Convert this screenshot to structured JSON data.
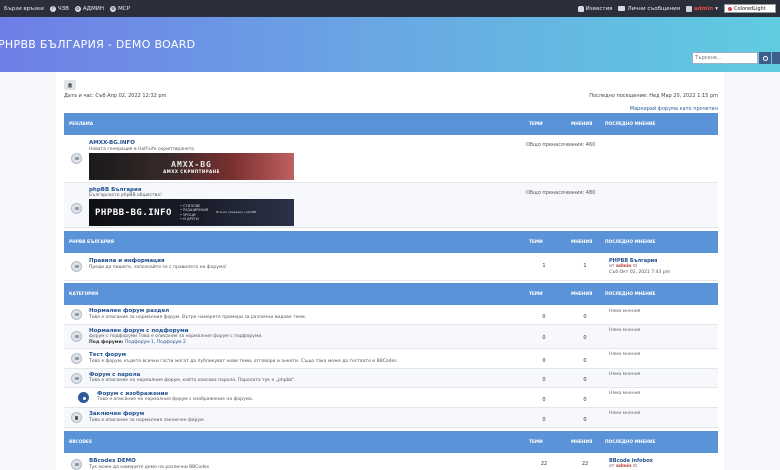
{
  "topbar": {
    "quick_links": "Бързи връзки",
    "faq": "ЧЗВ",
    "admin": "АДМИН",
    "mcp": "MCP",
    "notifications": "Известия",
    "pm": "Лични съобщения",
    "username": "admin",
    "style": "ColoredLight"
  },
  "header": {
    "site_title": "PHPBB БЪЛГАРИЯ - DEMO BOARD",
    "search_placeholder": "Търсене…"
  },
  "info": {
    "current_time": "Дата и час: Съб Апр 02, 2022 12:32 pm",
    "last_visit": "Последно посещение: Нед Мар 20, 2022 1:15 pm",
    "mark_read": "Маркирай форума като прочетен"
  },
  "columns": {
    "topics": "ТЕМИ",
    "posts": "МНЕНИЯ",
    "last_post": "ПОСЛЕДНО МНЕНИЕ"
  },
  "categories": [
    {
      "name": "РЕКЛАМА",
      "forums": [
        {
          "title": "AMXX-BG.INFO",
          "desc": "Новата генерация в Half-Life скриптирането",
          "redirects": "Общо пренасочвания: 460",
          "banner_title": "AMXX-BG",
          "banner_sub": "AMXX СКРИПТИРАНЕ"
        },
        {
          "title": "phpBB България",
          "desc": "Българското phpBB общество!",
          "redirects": "Общо пренасочвания: 480",
          "banner_title": "PHPBB-BG.INFO",
          "banner_lines": [
            "• СТИЛОВЕ",
            "• РАЗШИРЕНИЯ",
            "• УРОЦИ",
            "• И ДРУГИ"
          ],
          "banner_foot": "Всичко свързано с phpBB"
        }
      ]
    },
    {
      "name": "PHPBB БЪЛГАРИЯ",
      "forums": [
        {
          "title": "Правила и информация",
          "desc": "Преди да пишете, запознайте се с правилата на форума!",
          "topics": "1",
          "posts": "1",
          "last_title": "PHPBB България",
          "last_by_prefix": "от",
          "last_by": "admin",
          "last_date": "Съб Окт 02, 2021 7:43 pm"
        }
      ]
    },
    {
      "name": "КАТЕГОРИЯ",
      "forums": [
        {
          "title": "Нормален форум раздел",
          "desc": "Това е описание за нормалния форум. Вътре намерете примери за различни видове теми.",
          "topics": "0",
          "posts": "0",
          "last": "Няма мнения"
        },
        {
          "title": "Нормален форум с подфоруми",
          "desc": "форум с подфоруми Това е описание за нормалния форум с подфоруми.",
          "sub_label": "Под форуми:",
          "subforums": "Подфорум 1,  Подфорум 2",
          "topics": "0",
          "posts": "0",
          "last": "Няма мнения"
        },
        {
          "title": "Тест форум",
          "desc": "Това е форум, където всички гости могат да публикуват нови теми, отговори и анкети. Също така може да тествате и BBCodes",
          "topics": "0",
          "posts": "0",
          "last": "Няма мнения"
        },
        {
          "title": "Форум с парола",
          "desc": "Това е описание на нормалния форум, който изисква парола. Паролата тук е „phpbb\".",
          "topics": "0",
          "posts": "0",
          "last": "Няма мнения"
        },
        {
          "title": "Форум с изображение",
          "desc": "Това е описание на нормалния форум с изображение на форума.",
          "topics": "0",
          "posts": "0",
          "last": "Няма мнения"
        },
        {
          "title": "Заключен форум",
          "desc": "Това е описание за нормалния заключен форум.",
          "topics": "0",
          "posts": "0",
          "last": "Няма мнения"
        }
      ]
    },
    {
      "name": "BBCODES",
      "forums": [
        {
          "title": "BBcodes DEMO",
          "desc": "Тук може да намерите демо на различни BBCodes",
          "topics": "22",
          "posts": "22",
          "last_title": "BBcode infobox",
          "last_by_prefix": "от",
          "last_by": "admin"
        }
      ]
    }
  ]
}
